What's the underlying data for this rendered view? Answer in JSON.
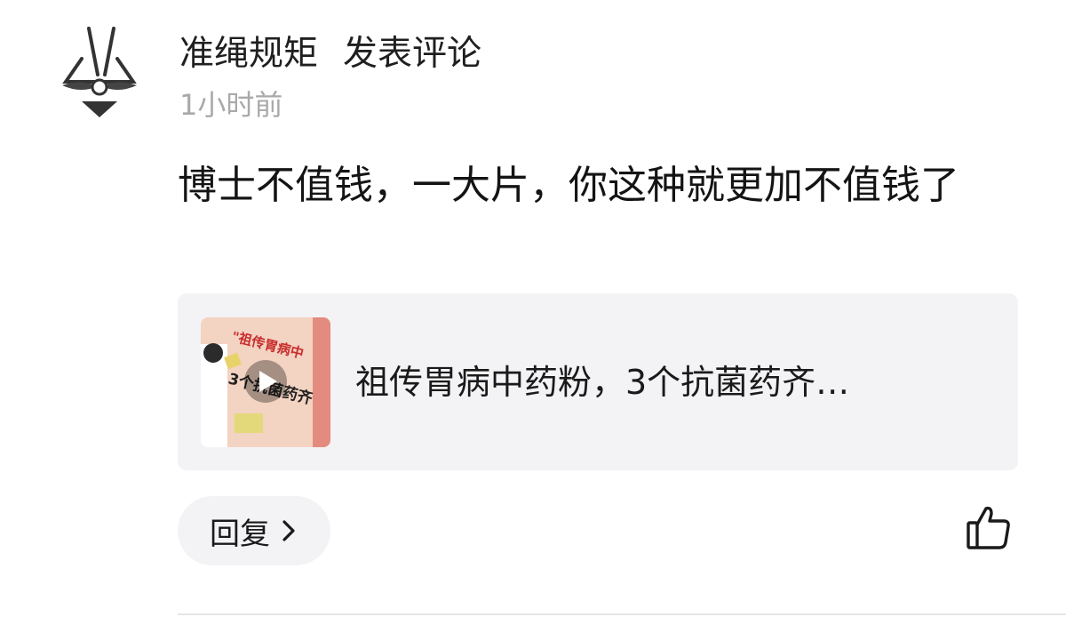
{
  "comment": {
    "author": "准绳规矩",
    "action": "发表评论",
    "time": "1小时前",
    "text": "博士不值钱，一大片，你这种就更加不值钱了"
  },
  "link_card": {
    "title": "祖传胃病中药粉，3个抗菌药齐…",
    "thumbnail": {
      "line1": "\"祖传胃病中",
      "line2": "3个抗菌药齐",
      "play_icon": "play-icon"
    }
  },
  "actions": {
    "reply_label": "回复",
    "reply_icon": "chevron-right-icon",
    "like_icon": "thumbs-up-icon"
  },
  "colors": {
    "text_primary": "#1a1a1a",
    "text_secondary": "#a9a9a9",
    "card_bg": "#f3f3f5",
    "thumb_bg": "#f3d3c2",
    "thumb_accent": "#c82e2e"
  }
}
